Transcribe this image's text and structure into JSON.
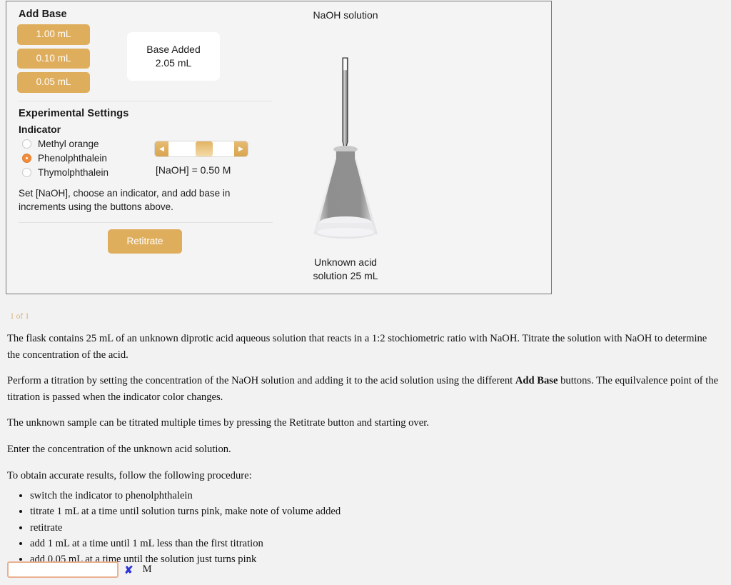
{
  "simulator": {
    "add_base": {
      "title": "Add Base",
      "buttons": [
        {
          "label": "1.00 mL",
          "name": "add-base-1-00-ml"
        },
        {
          "label": "0.10 mL",
          "name": "add-base-0-10-ml"
        },
        {
          "label": "0.05 mL",
          "name": "add-base-0-05-ml"
        }
      ]
    },
    "base_added": {
      "title": "Base Added",
      "value": "2.05 mL"
    },
    "experimental_settings": {
      "title": "Experimental Settings",
      "indicator_label": "Indicator",
      "indicator_options": [
        {
          "label": "Methyl orange",
          "selected": false
        },
        {
          "label": "Phenolphthalein",
          "selected": true
        },
        {
          "label": "Thymolphthalein",
          "selected": false
        }
      ],
      "concentration_readout": "[NaOH] = 0.50 M",
      "slider_left_arrow": "◀",
      "slider_right_arrow": "▶",
      "hint": "Set [NaOH], choose an indicator, and add base in increments using the buttons above.",
      "retitrate_label": "Retitrate"
    },
    "apparatus": {
      "burette_label": "NaOH solution",
      "flask_caption_line1": "Unknown acid",
      "flask_caption_line2": "solution 25 mL"
    },
    "colors": {
      "button_gold": "#dfae5d",
      "radio_selected": "#f08c3c",
      "page_counter": "#d9b075",
      "input_border": "#e9b191",
      "wrong_mark": "#2f35d8"
    }
  },
  "question": {
    "page_counter": "1 of 1",
    "paragraph_1_a": "The flask contains 25 mL of an unknown diprotic acid aqueous solution that reacts in a 1:2 stochiometric ratio with NaOH. Titrate the solution with NaOH to determine the concentration of the acid.",
    "paragraph_2_a": "Perform a titration by setting the concentration of the NaOH solution and adding it to the acid solution using the different ",
    "paragraph_2_bold": "Add Base",
    "paragraph_2_b": " buttons. The equilvalence point of the titration is passed when the indicator color changes.",
    "paragraph_3": "The unknown sample can be titrated multiple times by pressing the Retitrate button and starting over.",
    "paragraph_4": "Enter the concentration of the unknown acid solution.",
    "paragraph_5": "To obtain accurate results, follow the following procedure:",
    "procedure": [
      "switch the indicator to phenolphthalein",
      "titrate 1 mL at a time until solution turns pink, make note of volume added",
      "retitrate",
      "add 1 mL at a time until 1 mL less than the first titration",
      "add 0.05 mL at a time until the solution just turns pink"
    ],
    "answer": {
      "value": "",
      "placeholder": "",
      "wrong_mark": "✘",
      "unit": "M"
    }
  }
}
